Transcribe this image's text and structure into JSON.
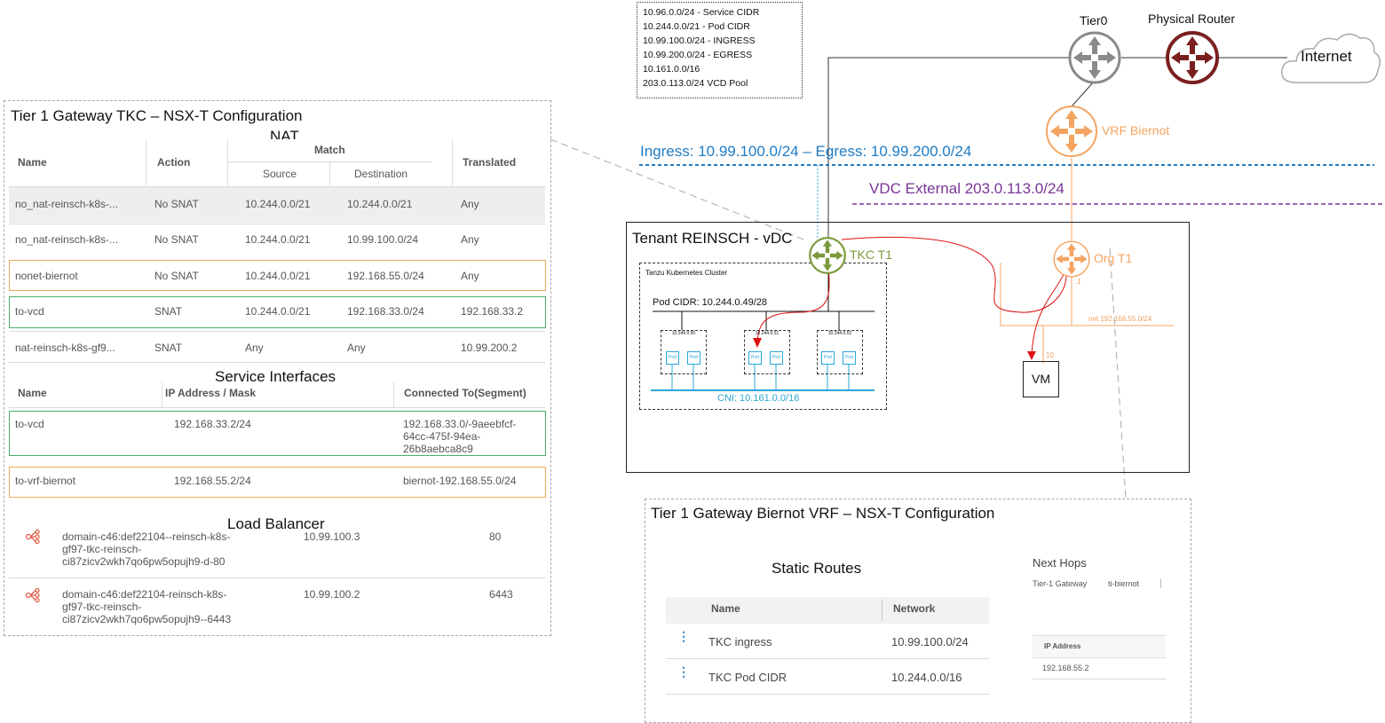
{
  "cidr_legend": [
    "10.96.0.0/24 - Service CIDR",
    "10.244.0.0/21 - Pod CIDR",
    "10.99.100.0/24 - INGRESS",
    "10.99.200.0/24 - EGRESS",
    "10.161.0.0/16",
    "203.0.113.0/24 VCD Pool"
  ],
  "routers": {
    "tier0": "Tier0",
    "physical": "Physical Router",
    "internet": "Internet",
    "vrf": "VRF Biernot",
    "tkc_t1": "TKC T1",
    "org_t1": "Org T1"
  },
  "networks": {
    "ingress_egress": "Ingress: 10.99.100.0/24 – Egress: 10.99.200.0/24",
    "vdc_external": "VDC External 203.0.113.0/24",
    "net_label": "net 192.168.55.0/24",
    "port_1": ".1",
    "port_10": "10"
  },
  "tenant": {
    "title": "Tenant REINSCH - vDC",
    "cluster": "Tanzu Kubernetes Cluster",
    "pod_cidr": "Pod CIDR: 10.244.0.49/28",
    "cni": "CNI: 10.161.0.0/16",
    "nodes": [
      "10.244.0.50",
      "10.244.0.51",
      "10.244.0.52"
    ],
    "pod_label": "Pod",
    "vm": "VM"
  },
  "tkc_config": {
    "title": "Tier 1 Gateway TKC – NSX-T Configuration",
    "nat_title": "NAT",
    "nat_headers": {
      "name": "Name",
      "action": "Action",
      "match": "Match",
      "source": "Source",
      "destination": "Destination",
      "translated": "Translated"
    },
    "nat_rows": [
      [
        "no_nat-reinsch-k8s-...",
        "No SNAT",
        "10.244.0.0/21",
        "10.244.0.0/21",
        "Any"
      ],
      [
        "no_nat-reinsch-k8s-...",
        "No SNAT",
        "10.244.0.0/21",
        "10.99.100.0/24",
        "Any"
      ],
      [
        "nonet-biernot",
        "No SNAT",
        "10.244.0.0/21",
        "192.168.55.0/24",
        "Any"
      ],
      [
        "to-vcd",
        "SNAT",
        "10.244.0.0/21",
        "192.168.33.0/24",
        "192.168.33.2"
      ],
      [
        "nat-reinsch-k8s-gf9...",
        "SNAT",
        "Any",
        "Any",
        "10.99.200.2"
      ]
    ],
    "si_title": "Service Interfaces",
    "si_headers": {
      "name": "Name",
      "ip": "IP Address / Mask",
      "connected": "Connected To(Segment)"
    },
    "si_rows": [
      {
        "name": "to-vcd",
        "ip": "192.168.33.2/24",
        "connected": [
          "192.168.33.0/-9aeebfcf-",
          "64cc-475f-94ea-",
          "26b8aebca8c9"
        ]
      },
      {
        "name": "to-vrf-biernot",
        "ip": "192.168.55.2/24",
        "connected": [
          "biernot-192.168.55.0/24"
        ]
      }
    ],
    "lb_title": "Load Balancer",
    "lb_rows": [
      {
        "name": [
          "domain-c46:def22104--reinsch-k8s-",
          "gf97-tkc-reinsch-",
          "ci87zicv2wkh7qo6pw5opujh9-d-80"
        ],
        "ip": "10.99.100.3",
        "port": "80"
      },
      {
        "name": [
          "domain-c46:def22104-reinsch-k8s-",
          "gf97-tkc-reinsch-",
          "ci87zicv2wkh7qo6pw5opujh9--6443"
        ],
        "ip": "10.99.100.2",
        "port": "6443"
      }
    ]
  },
  "vrf_config": {
    "title": "Tier 1 Gateway Biernot VRF  – NSX-T Configuration",
    "static_title": "Static Routes",
    "headers": {
      "name": "Name",
      "network": "Network"
    },
    "routes": [
      {
        "name": "TKC ingress",
        "network": "10.99.100.0/24"
      },
      {
        "name": "TKC Pod CIDR",
        "network": "10.244.0.0/16"
      }
    ],
    "next_hops_title": "Next Hops",
    "next_hops_row": [
      "Tier-1 Gateway",
      "ti-biernot"
    ],
    "ip_header": "IP Address",
    "ip_value": "192.168.55.2"
  },
  "colors": {
    "ingress": "#1f7cc4",
    "vdc_external": "#7a3598",
    "orange": "#f4a460",
    "green": "#7a9a3a",
    "red": "#dd1111",
    "blue": "#2aa7d9"
  }
}
